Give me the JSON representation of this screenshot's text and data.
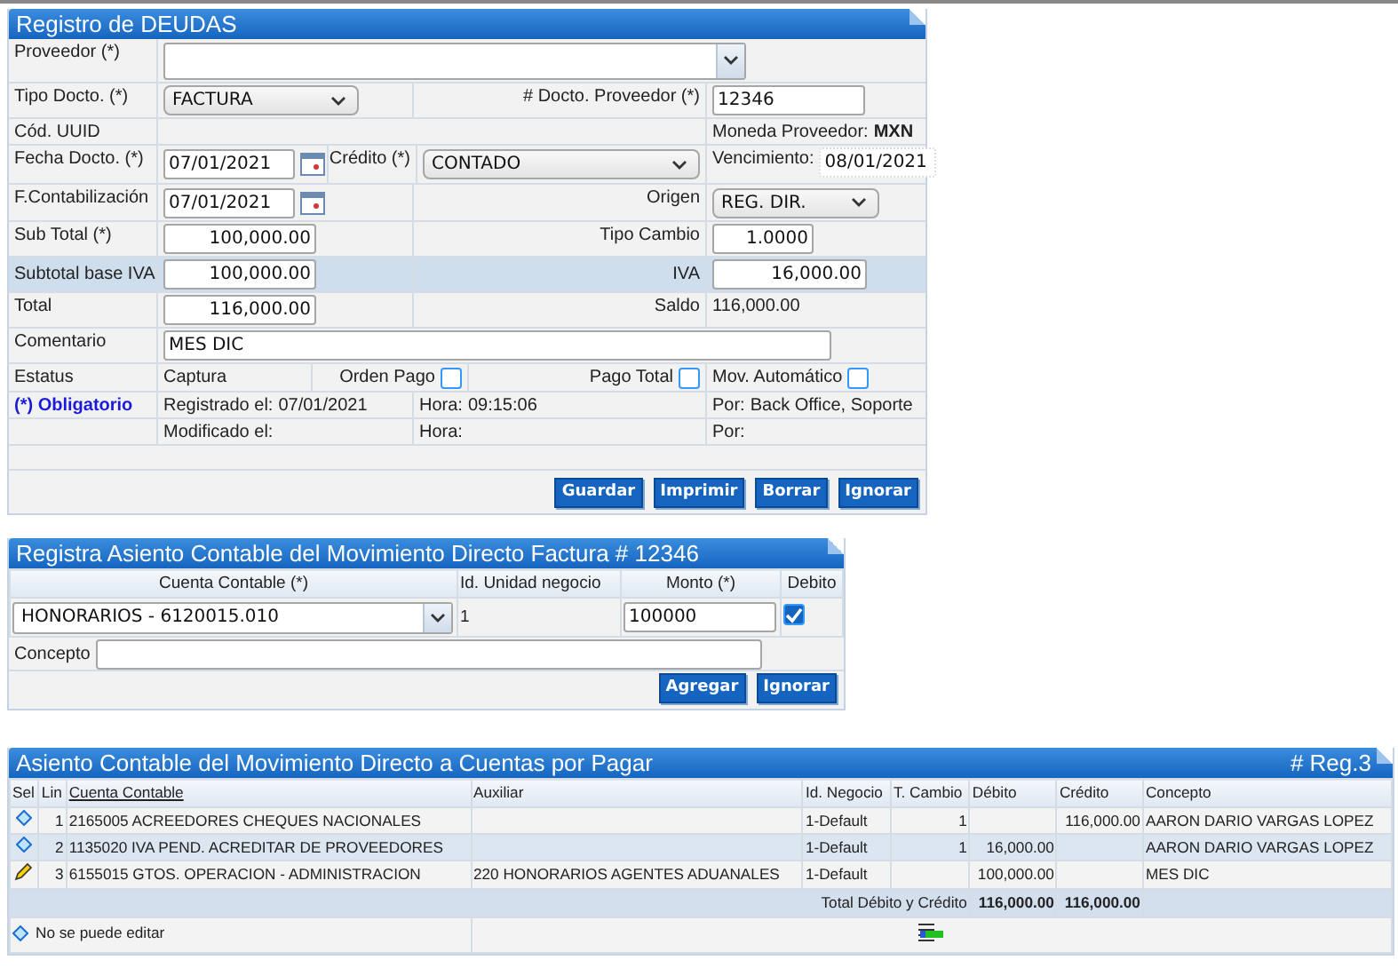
{
  "registro": {
    "title": "Registro de DEUDAS",
    "proveedor": {
      "label": "Proveedor (*)"
    },
    "tipo_docto": {
      "label": "Tipo Docto. (*)",
      "value": "FACTURA"
    },
    "docto_proveedor": {
      "label": "# Docto. Proveedor (*)",
      "value": "12346"
    },
    "uuid": {
      "label": "Cód. UUID"
    },
    "moneda": {
      "label": "Moneda Proveedor:",
      "value": "MXN"
    },
    "fecha_docto": {
      "label": "Fecha Docto. (*)",
      "value": "07/01/2021"
    },
    "credito": {
      "label": "Crédito (*)",
      "value": "CONTADO"
    },
    "vencimiento": {
      "label": "Vencimiento:",
      "value": "08/01/2021"
    },
    "f_contabilizacion": {
      "label": "F.Contabilización",
      "value": "07/01/2021"
    },
    "origen": {
      "label": "Origen",
      "value": "REG. DIR."
    },
    "sub_total": {
      "label": "Sub Total (*)",
      "value": "100,000.00"
    },
    "tipo_cambio": {
      "label": "Tipo Cambio",
      "value": "1.0000"
    },
    "subtotal_base_iva": {
      "label": "Subtotal base IVA",
      "value": "100,000.00"
    },
    "iva": {
      "label": "IVA",
      "value": "16,000.00"
    },
    "total": {
      "label": "Total",
      "value": "116,000.00"
    },
    "saldo": {
      "label": "Saldo",
      "value": "116,000.00"
    },
    "comentario": {
      "label": "Comentario",
      "value": "MES DIC"
    },
    "estatus": {
      "label": "Estatus",
      "value": "Captura"
    },
    "checks": [
      {
        "label": "Orden Pago",
        "checked": false
      },
      {
        "label": "Pago Total",
        "checked": false
      },
      {
        "label": "Mov. Automático",
        "checked": false
      }
    ],
    "required_note": "(*) Obligatorio",
    "audit": [
      {
        "label": "Registrado el:",
        "date": "07/01/2021",
        "hora_label": "Hora:",
        "hora": "09:15:06",
        "por_label": "Por:",
        "por": "Back Office, Soporte"
      },
      {
        "label": "Modificado el:",
        "hora_label": "Hora:",
        "por_label": "Por:"
      }
    ],
    "buttons": [
      "Guardar",
      "Imprimir",
      "Borrar",
      "Ignorar"
    ]
  },
  "asiento_form": {
    "title": "Registra Asiento Contable del Movimiento Directo Factura # 12346",
    "columns": [
      "Cuenta Contable (*)",
      "Id. Unidad negocio",
      "Monto (*)",
      "Debito"
    ],
    "cuenta": "HONORARIOS - 6120015.010",
    "unidad": "1",
    "monto": "100000",
    "debito": true,
    "concepto_label": "Concepto",
    "buttons": [
      "Agregar",
      "Ignorar"
    ]
  },
  "asiento_table": {
    "title": "Asiento Contable del Movimiento Directo a Cuentas por Pagar",
    "count": "# Reg.3",
    "columns": [
      "Sel",
      "Lin",
      "Cuenta Contable",
      "Auxiliar",
      "Id. Negocio",
      "T. Cambio",
      "Débito",
      "Crédito",
      "Concepto"
    ],
    "rows": [
      {
        "kind": "locked",
        "lin": "1",
        "cuenta": "2165005 ACREEDORES CHEQUES NACIONALES",
        "negocio": "1-Default",
        "cambio": "1",
        "credito": "116,000.00",
        "concepto": "AARON DARIO VARGAS LOPEZ"
      },
      {
        "kind": "locked",
        "lin": "2",
        "cuenta": "1135020 IVA PEND. ACREDITAR DE PROVEEDORES",
        "negocio": "1-Default",
        "cambio": "1",
        "debito": "16,000.00",
        "concepto": "AARON DARIO VARGAS LOPEZ"
      },
      {
        "kind": "editable",
        "lin": "3",
        "cuenta": "6155015 GTOS. OPERACION - ADMINISTRACION",
        "auxiliar": "220 HONORARIOS AGENTES ADUANALES",
        "negocio": "1-Default",
        "debito": "100,000.00",
        "concepto": "MES DIC"
      }
    ],
    "total_label": "Total Débito y Crédito",
    "total_debito": "116,000.00",
    "total_credito": "116,000.00",
    "legend": "No se puede editar"
  }
}
